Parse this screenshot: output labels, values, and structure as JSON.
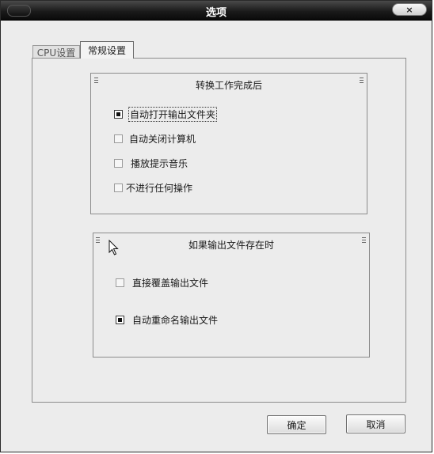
{
  "window": {
    "title": "选项",
    "close_glyph": "×"
  },
  "tabs": [
    {
      "label": "CPU设置",
      "selected": false
    },
    {
      "label": "常规设置",
      "selected": true
    }
  ],
  "group_after_convert": {
    "title": "转换工作完成后",
    "options": [
      {
        "label": "自动打开输出文件夹",
        "checked": true
      },
      {
        "label": "自动关闭计算机",
        "checked": false
      },
      {
        "label": "播放提示音乐",
        "checked": false
      },
      {
        "label": "不进行任何操作",
        "checked": false
      }
    ]
  },
  "group_file_exists": {
    "title": "如果输出文件存在时",
    "options": [
      {
        "label": "直接覆盖输出文件",
        "checked": false
      },
      {
        "label": "自动重命名输出文件",
        "checked": true
      }
    ]
  },
  "buttons": {
    "ok": "确定",
    "cancel": "取消"
  }
}
